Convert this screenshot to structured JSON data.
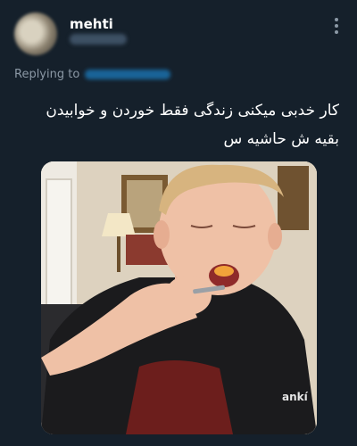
{
  "tweet": {
    "author": {
      "display_name": "mehti"
    },
    "replying_to_label": "Replying to",
    "text_lines": [
      "کار خدبی میکنی زندگی فقط خوردن و خوابیدن",
      "بقیه ش حاشیه س"
    ],
    "media": {
      "shirt_text": "ankí"
    }
  },
  "colors": {
    "background": "#15202b",
    "secondary_text": "#8b98a5",
    "accent": "#1d9bf0"
  },
  "icons": {
    "menu": "more-vertical-icon"
  }
}
